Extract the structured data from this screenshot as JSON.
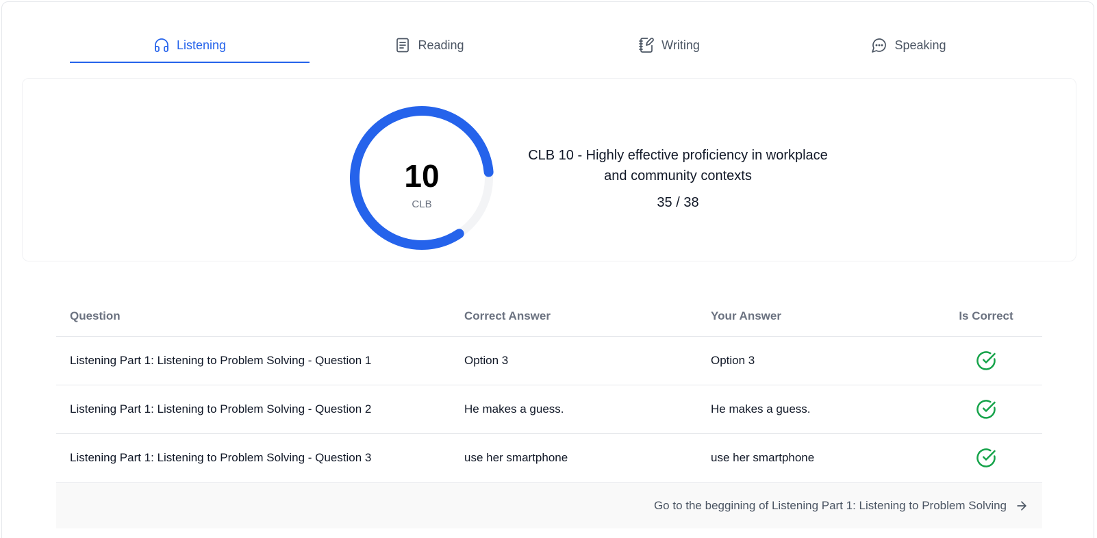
{
  "tabs": [
    {
      "label": "Listening",
      "icon": "headphones-icon",
      "active": true
    },
    {
      "label": "Reading",
      "icon": "document-icon",
      "active": false
    },
    {
      "label": "Writing",
      "icon": "notebook-pen-icon",
      "active": false
    },
    {
      "label": "Speaking",
      "icon": "chat-bubble-icon",
      "active": false
    }
  ],
  "result": {
    "level": "10",
    "level_unit": "CLB",
    "description": "CLB 10 - Highly effective proficiency in workplace and community contexts",
    "score_text": "35 / 38",
    "score": 35,
    "max_score": 38,
    "gauge_fill_fraction": 0.83,
    "gauge_color": "#2563eb",
    "gauge_track_color": "#f3f4f6"
  },
  "table": {
    "headers": [
      "Question",
      "Correct Answer",
      "Your Answer",
      "Is Correct"
    ],
    "rows": [
      {
        "question": "Listening Part 1: Listening to Problem Solving - Question 1",
        "correct_answer": "Option 3",
        "your_answer": "Option 3",
        "is_correct": true
      },
      {
        "question": "Listening Part 1: Listening to Problem Solving - Question 2",
        "correct_answer": "He makes a guess.",
        "your_answer": "He makes a guess.",
        "is_correct": true
      },
      {
        "question": "Listening Part 1: Listening to Problem Solving - Question 3",
        "correct_answer": "use her smartphone",
        "your_answer": "use her smartphone",
        "is_correct": true
      }
    ],
    "correct_icon": "check-circle-icon",
    "correct_color": "#16a34a"
  },
  "footer": {
    "link_label": "Go to the beggining of Listening Part 1: Listening to Problem Solving",
    "icon": "arrow-right-icon"
  }
}
